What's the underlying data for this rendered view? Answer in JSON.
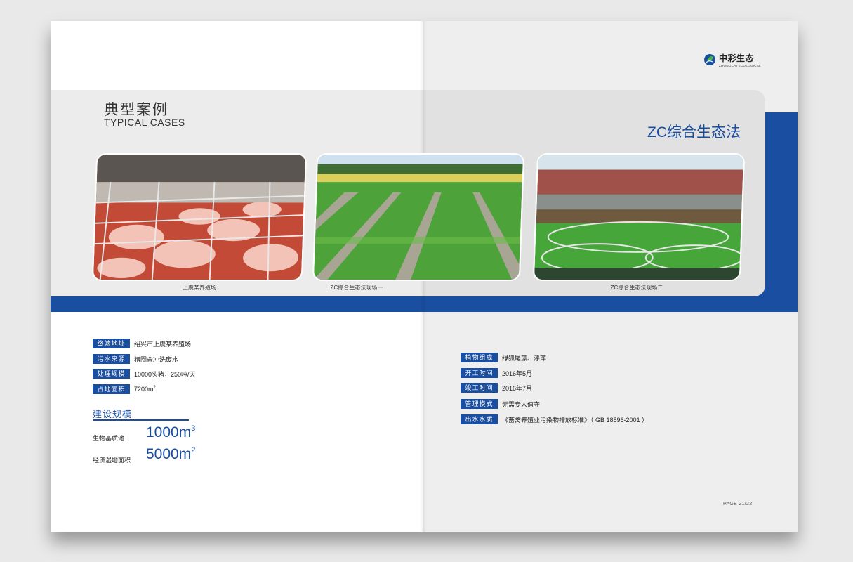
{
  "logo": {
    "name": "中彩生态",
    "sub": "ZHONGCAI ECOLOGICAL"
  },
  "header": {
    "title_cn": "典型案例",
    "title_en": "TYPICAL CASES",
    "method_title": "ZC综合生态法"
  },
  "photos": [
    {
      "caption": "上虞某养殖场",
      "icon": "pig-farm-photo"
    },
    {
      "caption": "ZC综合生态法现场一",
      "icon": "wetland-site-photo"
    },
    {
      "caption": "ZC综合生态法现场二",
      "icon": "pond-site-photo"
    }
  ],
  "left_info": [
    {
      "label": "终端地址",
      "value": "绍兴市上虞某养殖场"
    },
    {
      "label": "污水来源",
      "value": "猪圈舍冲洗废水"
    },
    {
      "label": "处理规模",
      "value": "10000头猪，250吨/天"
    },
    {
      "label": "占地面积",
      "value": "7200m",
      "sup": "2"
    }
  ],
  "build": {
    "title": "建设规模",
    "items": [
      {
        "label": "生物基质池",
        "value": "1000m",
        "sup": "3"
      },
      {
        "label": "经济湿地面积",
        "value": "5000m",
        "sup": "2"
      }
    ]
  },
  "right_info": [
    {
      "label": "植物组成",
      "value": "绿狐尾藻、浮萍"
    },
    {
      "label": "开工时间",
      "value": "2016年5月"
    },
    {
      "label": "竣工时间",
      "value": "2016年7月"
    },
    {
      "label": "管理模式",
      "value": "无需专人值守"
    },
    {
      "label": "出水水质",
      "value": "《畜禽养殖业污染物排放标准》（ GB 18596-2001 ）"
    }
  ],
  "page_number": "PAGE 21/22",
  "colors": {
    "accent": "#1a4ea0"
  }
}
